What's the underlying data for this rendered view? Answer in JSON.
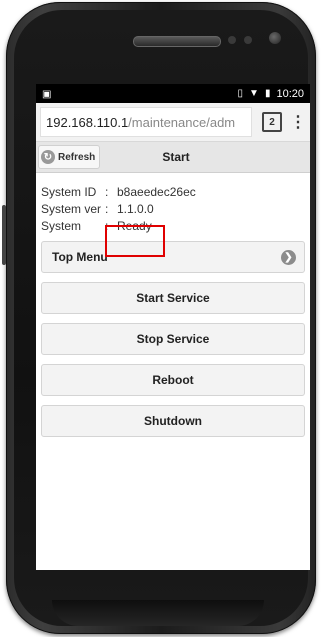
{
  "statusbar": {
    "notification_icon": "notification-icon",
    "vibrate_icon": "vibrate-icon",
    "wifi_icon": "wifi-icon",
    "battery_icon": "battery-icon",
    "time": "10:20"
  },
  "browser": {
    "url_host": "192.168.110.1",
    "url_path": "/maintenance/adm",
    "tab_count": "2"
  },
  "header": {
    "refresh_label": "Refresh",
    "title": "Start"
  },
  "system_info": {
    "rows": [
      {
        "label": "System ID",
        "sep": ":",
        "value": "b8aeedec26ec"
      },
      {
        "label": "System ver",
        "sep": ":",
        "value": "1.1.0.0"
      },
      {
        "label": "System",
        "sep": ":",
        "value": "Ready"
      }
    ]
  },
  "menu": {
    "top_menu_label": "Top Menu"
  },
  "actions": {
    "start_service": "Start Service",
    "stop_service": "Stop Service",
    "reboot": "Reboot",
    "shutdown": "Shutdown"
  },
  "colors": {
    "highlight": "#e00000",
    "button_bg": "#f3f3f3",
    "header_bg": "#e6e6e6"
  }
}
